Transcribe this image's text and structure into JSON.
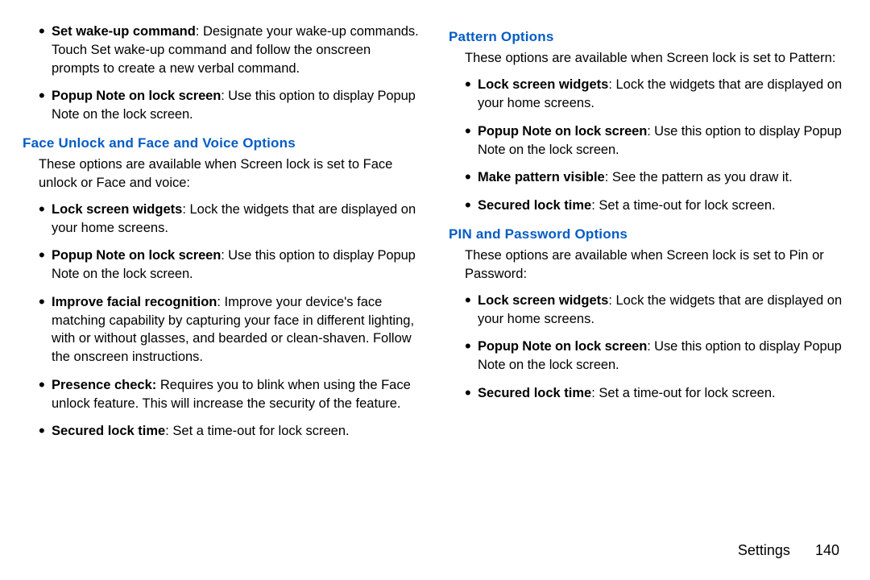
{
  "left": {
    "topBullets": [
      {
        "bold": "Set wake-up command",
        "text": ": Designate your wake-up commands. Touch Set wake-up command and follow the onscreen prompts to create a new verbal command.",
        "condensed": false
      },
      {
        "bold": "Popup Note on lock screen",
        "text": ": Use this option to display Popup Note on the lock screen.",
        "condensed": true
      }
    ],
    "section1": {
      "heading": "Face Unlock and Face and Voice Options",
      "intro": "These options are available when Screen lock is set to Face unlock or Face and voice:",
      "bullets": [
        {
          "bold": "Lock screen widgets",
          "text": ": Lock the widgets that are displayed on your home screens.",
          "condensed": false
        },
        {
          "bold": "Popup Note on lock screen",
          "text": ": Use this option to display Popup Note on the lock screen.",
          "condensed": true
        },
        {
          "bold": "Improve facial recognition",
          "text": ": Improve your device's face matching capability by capturing your face in different lighting, with or without glasses, and bearded or clean-shaven. Follow the onscreen instructions.",
          "condensed": false
        },
        {
          "bold": "Presence check:",
          "text": " Requires you to blink when using the Face unlock feature. This will increase the security of the feature.",
          "condensed": false
        },
        {
          "bold": "Secured lock time",
          "text": ": Set a time-out for lock screen.",
          "condensed": false
        }
      ]
    }
  },
  "right": {
    "section2": {
      "heading": "Pattern Options",
      "intro": "These options are available when Screen lock is set to Pattern:",
      "bullets": [
        {
          "bold": "Lock screen widgets",
          "text": ": Lock the widgets that are displayed on your home screens.",
          "condensed": false
        },
        {
          "bold": "Popup Note on lock screen",
          "text": ": Use this option to display Popup Note on the lock screen.",
          "condensed": true
        },
        {
          "bold": "Make pattern visible",
          "text": ": See the pattern as you draw it.",
          "condensed": false
        },
        {
          "bold": "Secured lock time",
          "text": ": Set a time-out for lock screen.",
          "condensed": false
        }
      ]
    },
    "section3": {
      "heading": "PIN and Password Options",
      "intro": "These options are available when Screen lock is set to Pin or Password:",
      "bullets": [
        {
          "bold": "Lock screen widgets",
          "text": ": Lock the widgets that are displayed on your home screens.",
          "condensed": false
        },
        {
          "bold": "Popup Note on lock screen",
          "text": ": Use this option to display Popup Note on the lock screen.",
          "condensed": true
        },
        {
          "bold": "Secured lock time",
          "text": ": Set a time-out for lock screen.",
          "condensed": false
        }
      ]
    }
  },
  "footer": {
    "label": "Settings",
    "page": "140"
  }
}
